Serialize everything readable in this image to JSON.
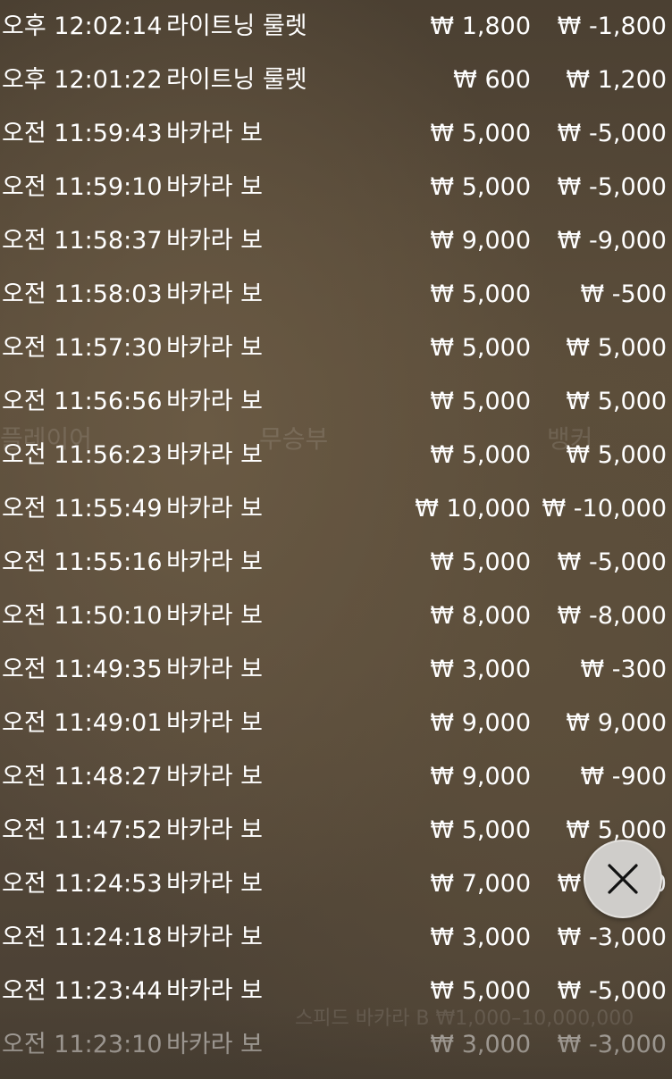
{
  "currency_symbol": "₩",
  "background_ghost": {
    "player_label": "플레이어",
    "tie_label": "무승부",
    "banker_label": "뱅커",
    "table_caption": "스피드 바카라 B ₩1,000–10,000,000"
  },
  "history": [
    {
      "time": "오후 12:02:14",
      "game": "라이트닝 룰렛",
      "bet": "₩ 1,800",
      "win": "₩ -1,800"
    },
    {
      "time": "오후 12:01:22",
      "game": "라이트닝 룰렛",
      "bet": "₩ 600",
      "win": "₩ 1,200"
    },
    {
      "time": "오전 11:59:43",
      "game": "바카라 보",
      "bet": "₩ 5,000",
      "win": "₩ -5,000"
    },
    {
      "time": "오전 11:59:10",
      "game": "바카라 보",
      "bet": "₩ 5,000",
      "win": "₩ -5,000"
    },
    {
      "time": "오전 11:58:37",
      "game": "바카라 보",
      "bet": "₩ 9,000",
      "win": "₩ -9,000"
    },
    {
      "time": "오전 11:58:03",
      "game": "바카라 보",
      "bet": "₩ 5,000",
      "win": "₩ -500"
    },
    {
      "time": "오전 11:57:30",
      "game": "바카라 보",
      "bet": "₩ 5,000",
      "win": "₩ 5,000"
    },
    {
      "time": "오전 11:56:56",
      "game": "바카라 보",
      "bet": "₩ 5,000",
      "win": "₩ 5,000"
    },
    {
      "time": "오전 11:56:23",
      "game": "바카라 보",
      "bet": "₩ 5,000",
      "win": "₩ 5,000"
    },
    {
      "time": "오전 11:55:49",
      "game": "바카라 보",
      "bet": "₩ 10,000",
      "win": "₩ -10,000"
    },
    {
      "time": "오전 11:55:16",
      "game": "바카라 보",
      "bet": "₩ 5,000",
      "win": "₩ -5,000"
    },
    {
      "time": "오전 11:50:10",
      "game": "바카라 보",
      "bet": "₩ 8,000",
      "win": "₩ -8,000"
    },
    {
      "time": "오전 11:49:35",
      "game": "바카라 보",
      "bet": "₩ 3,000",
      "win": "₩ -300"
    },
    {
      "time": "오전 11:49:01",
      "game": "바카라 보",
      "bet": "₩ 9,000",
      "win": "₩ 9,000"
    },
    {
      "time": "오전 11:48:27",
      "game": "바카라 보",
      "bet": "₩ 9,000",
      "win": "₩ -900"
    },
    {
      "time": "오전 11:47:52",
      "game": "바카라 보",
      "bet": "₩ 5,000",
      "win": "₩ 5,000"
    },
    {
      "time": "오전 11:24:53",
      "game": "바카라 보",
      "bet": "₩ 7,000",
      "win": "₩ -7,000"
    },
    {
      "time": "오전 11:24:18",
      "game": "바카라 보",
      "bet": "₩ 3,000",
      "win": "₩ -3,000"
    },
    {
      "time": "오전 11:23:44",
      "game": "바카라 보",
      "bet": "₩ 5,000",
      "win": "₩ -5,000"
    },
    {
      "time": "오전 11:23:10",
      "game": "바카라 보",
      "bet": "₩ 3,000",
      "win": "₩ -3,000"
    }
  ],
  "close_button": {
    "icon": "close-icon"
  }
}
